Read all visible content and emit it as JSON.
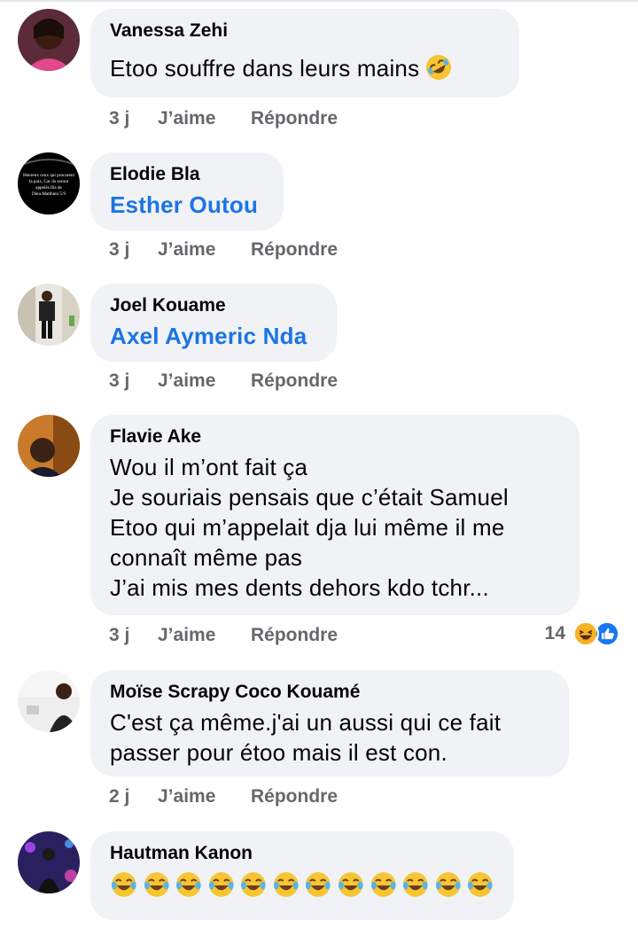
{
  "comments": [
    {
      "author": "Vanessa Zehi",
      "text": "Etoo souffre dans leurs mains",
      "emoji": "rolling-on-floor-laughing-emoji",
      "time": "3 j",
      "like_label": "J’aime",
      "reply_label": "Répondre"
    },
    {
      "author": "Elodie Bla",
      "text": "Esther Outou",
      "time": "3 j",
      "like_label": "J’aime",
      "reply_label": "Répondre",
      "avatar_text": "Heureux ceux qui procurent la paix, Car ils seront appelés fils de Dieu.Matthieu 5:9"
    },
    {
      "author": "Joel Kouame",
      "text": "Axel Aymeric Nda",
      "time": "3 j",
      "like_label": "J’aime",
      "reply_label": "Répondre"
    },
    {
      "author": "Flavie Ake",
      "text": "Wou il m’ont fait ça\nJe souriais pensais que c’était Samuel\nEtoo qui m’appelait dja lui même il me\nconnaît même pas\nJ’ai mis mes dents dehors kdo tchr...",
      "time": "3 j",
      "like_label": "J’aime",
      "reply_label": "Répondre",
      "reaction_count": "14",
      "reaction_icons": [
        "haha-icon",
        "like-icon"
      ]
    },
    {
      "author": "Moïse Scrapy Coco Kouamé",
      "text": "C'est ça même.j'ai un aussi qui ce fait\npasser pour étoo mais il est con.",
      "time": "2 j",
      "like_label": "J’aime",
      "reply_label": "Répondre"
    },
    {
      "author": "Hautman Kanon",
      "emoji_count": 12,
      "emoji": "face-with-tears-of-joy-emoji"
    }
  ],
  "colors": {
    "bubble": "#f0f2f5",
    "mention": "#1b74e4",
    "meta": "#65676b",
    "like_blue": "#1877f2",
    "haha_yellow": "#f7b125"
  }
}
